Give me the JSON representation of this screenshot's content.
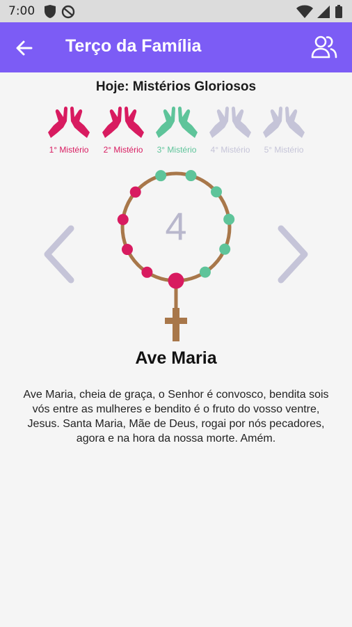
{
  "status": {
    "time": "7:00"
  },
  "app_bar": {
    "title": "Terço da Família"
  },
  "today_label": "Hoje: Mistérios Gloriosos",
  "mysteries": [
    {
      "label": "1° Mistério",
      "state": "done",
      "color": "#d81b60"
    },
    {
      "label": "2° Mistério",
      "state": "done",
      "color": "#d81b60"
    },
    {
      "label": "3° Mistério",
      "state": "current",
      "color": "#5ec49a"
    },
    {
      "label": "4° Mistério",
      "state": "pending",
      "color": "#c5c4d8"
    },
    {
      "label": "5° Mistério",
      "state": "pending",
      "color": "#c5c4d8"
    }
  ],
  "rosary": {
    "count": "4",
    "bead_done_color": "#d81b60",
    "bead_pending_color": "#5ec49a",
    "string_color": "#a8774a"
  },
  "prayer": {
    "title": "Ave Maria",
    "text": "Ave Maria, cheia de graça, o Senhor é convosco, bendita sois vós entre as mulheres e bendito é o fruto do vosso ventre, Jesus. Santa Maria, Mãe de Deus, rogai por nós pecadores, agora e na hora da nossa morte. Amém."
  },
  "colors": {
    "accent": "#7c5cf5",
    "arrow": "#c5c4d8"
  }
}
